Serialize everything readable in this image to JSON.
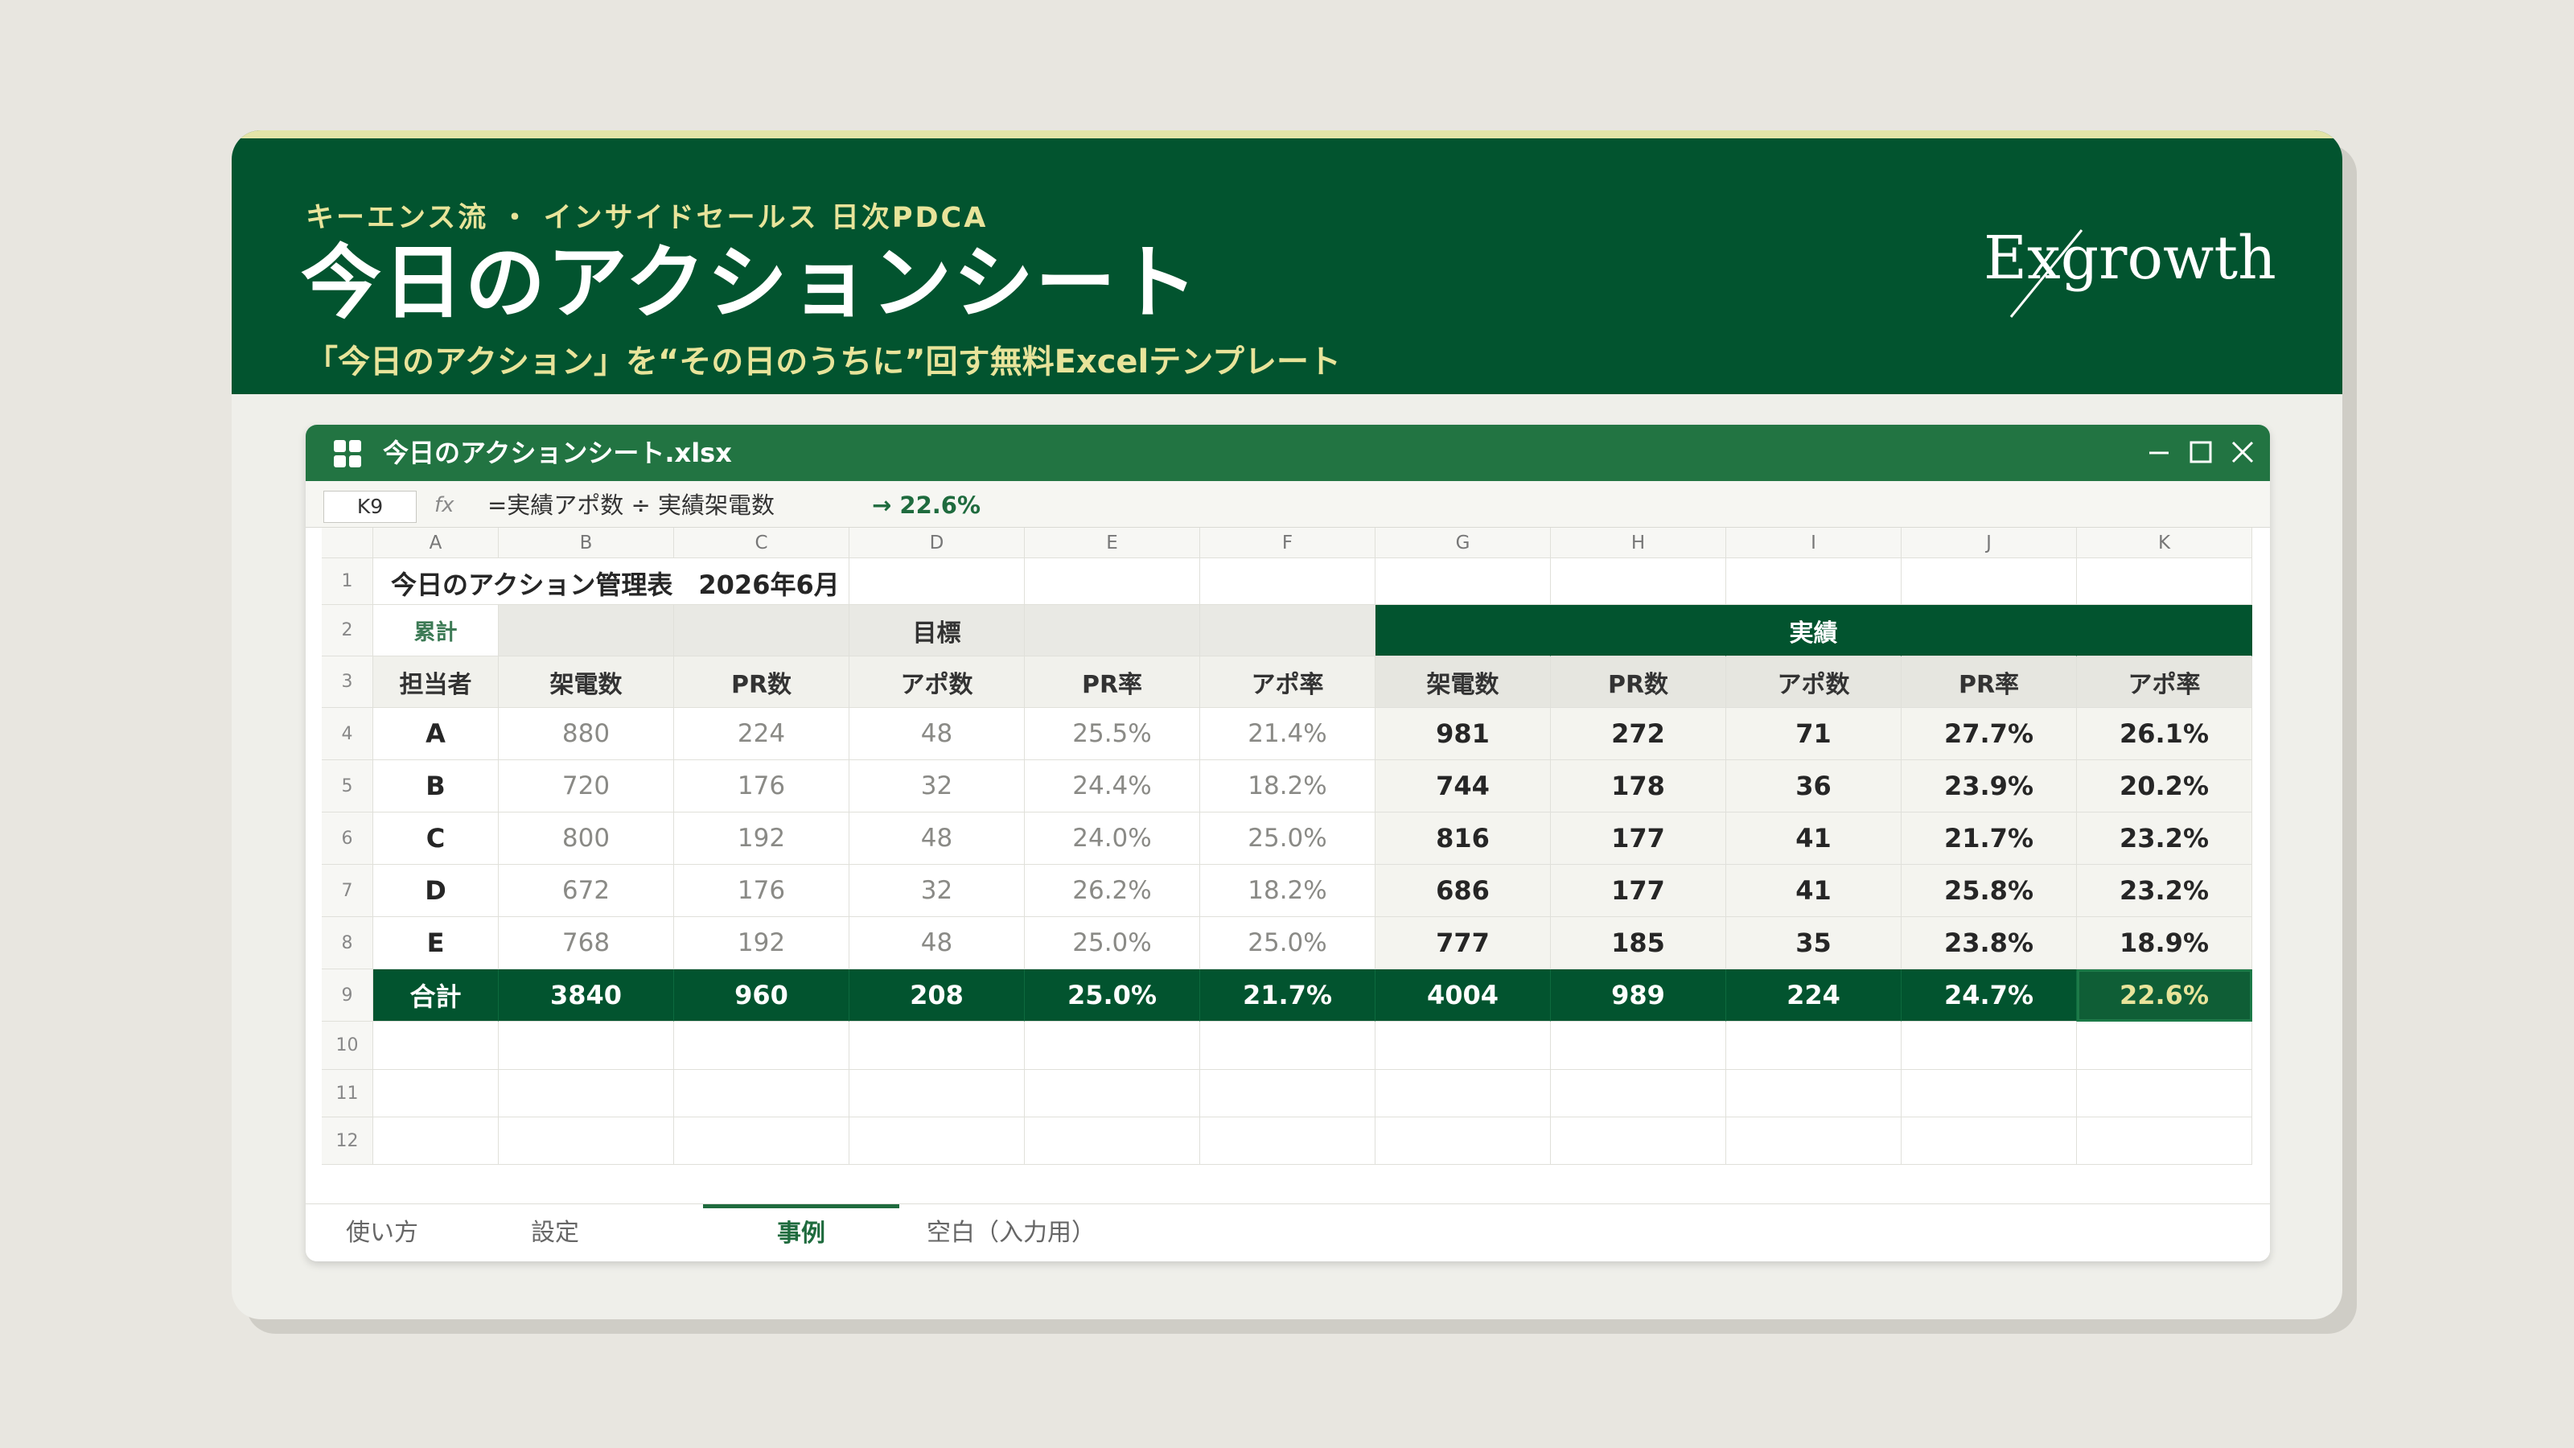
{
  "header": {
    "kicker": "キーエンス流 ・ インサイドセールス 日次PDCA",
    "title": "今日のアクションシート",
    "subtitle": "「今日のアクション」を“その日のうちに”回す無料Excelテンプレート",
    "logo": "Exgrowth"
  },
  "window": {
    "filename": "今日のアクションシート.xlsx",
    "app_icon": "grid-icon",
    "controls": [
      "minimize-icon",
      "maximize-icon",
      "close-icon"
    ]
  },
  "formula_bar": {
    "cell_ref": "K9",
    "fx": "fx",
    "formula": "=実績アポ数 ÷ 実績架電数",
    "result": "→ 22.6%"
  },
  "sheet": {
    "columns": [
      "A",
      "B",
      "C",
      "D",
      "E",
      "F",
      "G",
      "H",
      "I",
      "J",
      "K"
    ],
    "row_numbers": [
      "1",
      "2",
      "3",
      "4",
      "5",
      "6",
      "7",
      "8",
      "9",
      "10",
      "11",
      "12"
    ],
    "row1_title": "今日のアクション管理表　2026年6月",
    "row2": {
      "cumulative": "累計",
      "target": "目標",
      "actual": "実績"
    },
    "headers": [
      "担当者",
      "架電数",
      "PR数",
      "アポ数",
      "PR率",
      "アポ率",
      "架電数",
      "PR数",
      "アポ数",
      "PR率",
      "アポ率"
    ],
    "rows": [
      [
        "A",
        "880",
        "224",
        "48",
        "25.5%",
        "21.4%",
        "981",
        "272",
        "71",
        "27.7%",
        "26.1%"
      ],
      [
        "B",
        "720",
        "176",
        "32",
        "24.4%",
        "18.2%",
        "744",
        "178",
        "36",
        "23.9%",
        "20.2%"
      ],
      [
        "C",
        "800",
        "192",
        "48",
        "24.0%",
        "25.0%",
        "816",
        "177",
        "41",
        "21.7%",
        "23.2%"
      ],
      [
        "D",
        "672",
        "176",
        "32",
        "26.2%",
        "18.2%",
        "686",
        "177",
        "41",
        "25.8%",
        "23.2%"
      ],
      [
        "E",
        "768",
        "192",
        "48",
        "25.0%",
        "25.0%",
        "777",
        "185",
        "35",
        "23.8%",
        "18.9%"
      ]
    ],
    "total": [
      "合計",
      "3840",
      "960",
      "208",
      "25.0%",
      "21.7%",
      "4004",
      "989",
      "224",
      "24.7%",
      "22.6%"
    ],
    "selected_cell": "K9"
  },
  "tabs": [
    {
      "label": "使い方",
      "active": false
    },
    {
      "label": "設定",
      "active": false
    },
    {
      "label": "事例",
      "active": true
    },
    {
      "label": "空白（入力用）",
      "active": false
    }
  ],
  "colors": {
    "brand_green": "#02542f",
    "titlebar_green": "#227442",
    "accent_yellow": "#e8e49a",
    "background": "#e8e6e0"
  }
}
